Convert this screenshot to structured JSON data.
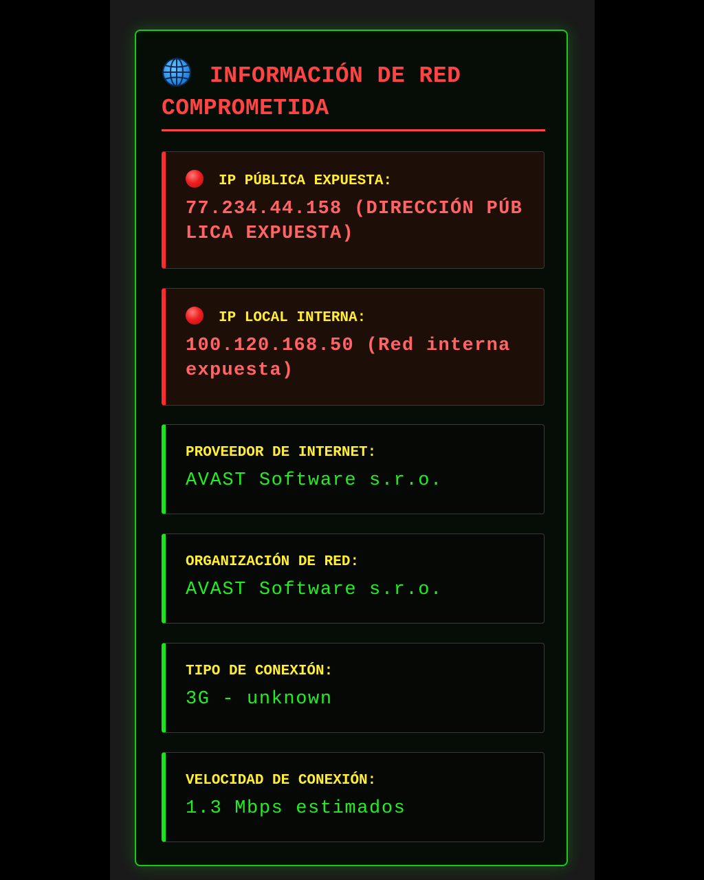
{
  "panel": {
    "icon": "globe-icon",
    "title": "INFORMACIÓN DE RED COMPROMETIDA"
  },
  "cards": [
    {
      "status": "alert",
      "icon": "red-circle-icon",
      "label": "IP PÚBLICA EXPUESTA:",
      "value": "77.234.44.158 (DIRECCIÓN PÚBLICA EXPUESTA)"
    },
    {
      "status": "alert",
      "icon": "red-circle-icon",
      "label": "IP LOCAL INTERNA:",
      "value": "100.120.168.50 (Red interna expuesta)"
    },
    {
      "status": "info",
      "label": "PROVEEDOR DE INTERNET:",
      "value": "AVAST Software s.r.o."
    },
    {
      "status": "info",
      "label": "ORGANIZACIÓN DE RED:",
      "value": "AVAST Software s.r.o."
    },
    {
      "status": "info",
      "label": "TIPO DE CONEXIÓN:",
      "value": "3G - unknown"
    },
    {
      "status": "info",
      "label": "VELOCIDAD DE CONEXIÓN:",
      "value": "1.3 Mbps estimados"
    }
  ],
  "colors": {
    "alert": "#ff4444",
    "alert_value": "#ff6565",
    "label": "#ffee33",
    "ok_value": "#22ee22",
    "panel_border": "#1ec71e",
    "page_background": "#000000"
  }
}
